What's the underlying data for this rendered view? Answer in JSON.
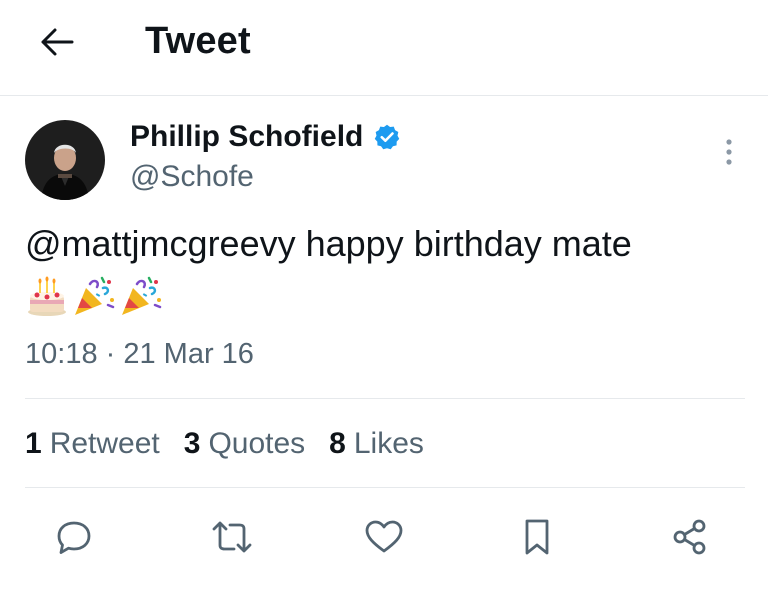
{
  "header": {
    "title": "Tweet",
    "back_icon": "arrow-left-icon"
  },
  "author": {
    "name": "Phillip Schofield",
    "handle": "@Schofe",
    "verified": true,
    "verified_color": "#1d9bf0",
    "avatar_icon": "profile-photo"
  },
  "tweet": {
    "text": "@mattjmcgreevy happy birthday mate",
    "emojis": [
      "birthday-cake-emoji",
      "party-popper-emoji",
      "party-popper-emoji"
    ],
    "timestamp": "10:18 · 21 Mar 16"
  },
  "stats": [
    {
      "count": "1",
      "label": "Retweet"
    },
    {
      "count": "3",
      "label": "Quotes"
    },
    {
      "count": "8",
      "label": "Likes"
    }
  ],
  "actions": [
    {
      "name": "reply",
      "icon": "reply-icon"
    },
    {
      "name": "retweet",
      "icon": "retweet-icon"
    },
    {
      "name": "like",
      "icon": "heart-icon"
    },
    {
      "name": "bookmark",
      "icon": "bookmark-icon"
    },
    {
      "name": "share",
      "icon": "share-icon"
    }
  ],
  "colors": {
    "text": "#0f1419",
    "secondary": "#536471",
    "accent": "#1d9bf0",
    "border": "#e6e9ec"
  }
}
